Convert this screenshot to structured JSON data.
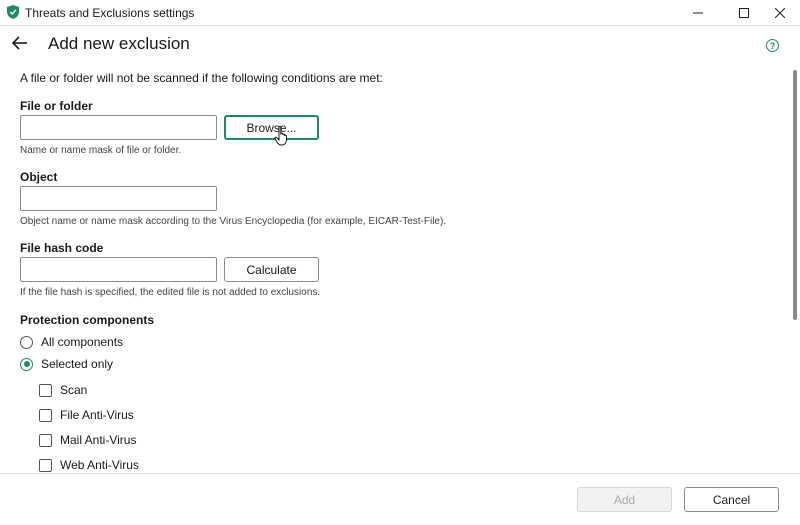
{
  "window": {
    "title": "Threats and Exclusions settings",
    "accent_color": "#1d8b6a"
  },
  "header": {
    "title": "Add new exclusion",
    "help_glyph": "?"
  },
  "intro": "A file or folder will not be scanned if the following conditions are met:",
  "file_or_folder": {
    "label": "File or folder",
    "value": "",
    "browse_label": "Browse...",
    "hint": "Name or name mask of file or folder."
  },
  "object": {
    "label": "Object",
    "value": "",
    "hint": "Object name or name mask according to the Virus Encyclopedia (for example, EICAR-Test-File)."
  },
  "file_hash": {
    "label": "File hash code",
    "value": "",
    "calculate_label": "Calculate",
    "hint": "If the file hash is specified, the edited file is not added to exclusions."
  },
  "protection": {
    "label": "Protection components",
    "options": [
      {
        "label": "All components",
        "selected": false
      },
      {
        "label": "Selected only",
        "selected": true
      }
    ],
    "components": [
      {
        "label": "Scan",
        "checked": false
      },
      {
        "label": "File Anti-Virus",
        "checked": false
      },
      {
        "label": "Mail Anti-Virus",
        "checked": false
      },
      {
        "label": "Web Anti-Virus",
        "checked": false
      }
    ]
  },
  "footer": {
    "add_label": "Add",
    "add_enabled": false,
    "cancel_label": "Cancel"
  }
}
